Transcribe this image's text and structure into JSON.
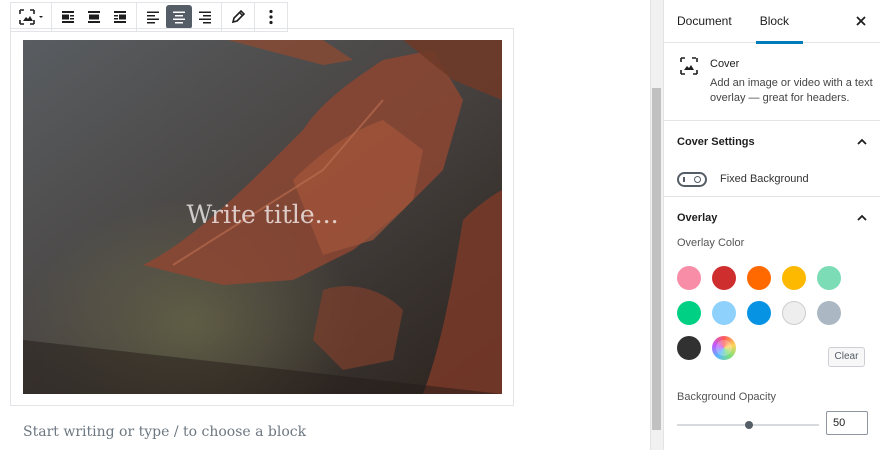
{
  "editor": {
    "toolbar": {
      "buttons": [
        {
          "name": "block-type-cover",
          "icon": "cover-icon"
        },
        {
          "name": "align-left-wide",
          "icon": "media-left-icon"
        },
        {
          "name": "align-center-wide",
          "icon": "media-center-icon"
        },
        {
          "name": "align-right-wide",
          "icon": "media-right-icon"
        },
        {
          "name": "text-align-left",
          "icon": "align-left-icon"
        },
        {
          "name": "text-align-center",
          "icon": "align-center-icon",
          "active": true
        },
        {
          "name": "text-align-right",
          "icon": "align-right-icon"
        },
        {
          "name": "edit-media",
          "icon": "pencil-icon"
        },
        {
          "name": "more-options",
          "icon": "ellipsis-vertical-icon"
        }
      ]
    },
    "cover": {
      "title_placeholder": "Write title..."
    },
    "appender_placeholder": "Start writing or type / to choose a block"
  },
  "sidebar": {
    "tabs": [
      {
        "label": "Document",
        "active": false
      },
      {
        "label": "Block",
        "active": true
      }
    ],
    "block_card": {
      "name": "Cover",
      "description": "Add an image or video with a text overlay — great for headers."
    },
    "cover_settings": {
      "title": "Cover Settings",
      "fixed_background_label": "Fixed Background",
      "fixed_background": false
    },
    "overlay": {
      "title": "Overlay",
      "color_label": "Overlay Color",
      "colors": [
        "#f78da7",
        "#cf2e2e",
        "#ff6900",
        "#fcb900",
        "#7bdcb5",
        "#00d084",
        "#8ed1fc",
        "#0693e3",
        "#eeeeee",
        "#abb8c3",
        "#313131",
        "custom-gradient"
      ],
      "clear_label": "Clear",
      "opacity_label": "Background Opacity",
      "opacity_value": "50",
      "opacity_fraction": 0.5
    }
  },
  "colors": {
    "accent": "#007cba",
    "toolbar_active": "#555d66"
  }
}
